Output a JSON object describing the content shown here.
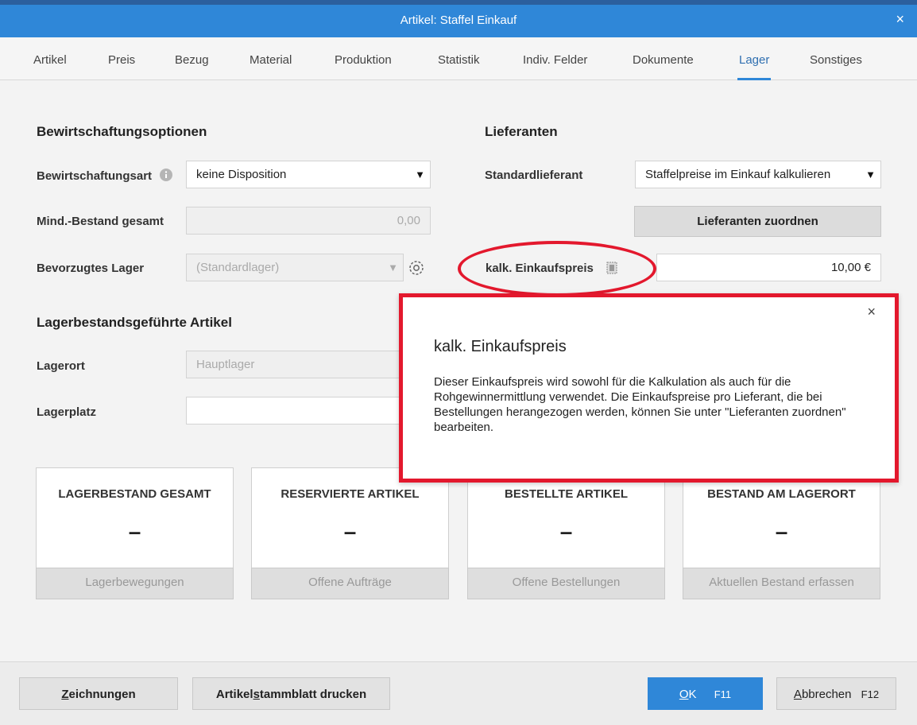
{
  "window": {
    "title": "Artikel: Staffel Einkauf",
    "close_symbol": "×"
  },
  "tabs": [
    {
      "label": "Artikel"
    },
    {
      "label": "Preis"
    },
    {
      "label": "Bezug"
    },
    {
      "label": "Material"
    },
    {
      "label": "Produktion"
    },
    {
      "label": "Statistik"
    },
    {
      "label": "Indiv. Felder"
    },
    {
      "label": "Dokumente"
    },
    {
      "label": "Lager"
    },
    {
      "label": "Sonstiges"
    }
  ],
  "active_tab": "Lager",
  "left": {
    "section_title": "Bewirtschaftungsoptionen",
    "bewirtschaftungsart": {
      "label": "Bewirtschaftungsart",
      "value": "keine Disposition"
    },
    "mind_bestand": {
      "label": "Mind.-Bestand gesamt",
      "value": "0,00"
    },
    "bevorzugtes_lager": {
      "label": "Bevorzugtes Lager",
      "value": "(Standardlager)"
    }
  },
  "lager_section": {
    "title": "Lagerbestandsgeführte Artikel",
    "lagerort": {
      "label": "Lagerort",
      "value": "Hauptlager"
    },
    "lagerplatz": {
      "label": "Lagerplatz",
      "value": ""
    }
  },
  "right": {
    "section_title": "Lieferanten",
    "standardlieferant": {
      "label": "Standardlieferant",
      "value": "Staffelpreise im Einkauf kalkulieren"
    },
    "assign_button": "Lieferanten zuordnen",
    "kalk": {
      "label": "kalk. Einkaufspreis",
      "value": "10,00 €"
    }
  },
  "tooltip": {
    "title": "kalk. Einkaufspreis",
    "body": "Dieser Einkaufspreis wird sowohl für die Kalkulation als auch für die Rohgewinnermittlung verwendet. Die Einkaufspreise pro Lieferant, die bei Bestellungen herangezogen werden, können Sie unter \"Lieferanten zuordnen\" bearbeiten.",
    "close": "×"
  },
  "cards": [
    {
      "title": "LAGERBESTAND GESAMT",
      "value": "–",
      "button": "Lagerbewegungen"
    },
    {
      "title": "RESERVIERTE ARTIKEL",
      "value": "–",
      "button": "Offene Aufträge"
    },
    {
      "title": "BESTELLTE ARTIKEL",
      "value": "–",
      "button": "Offene Bestellungen"
    },
    {
      "title": "BESTAND AM LAGERORT",
      "value": "–",
      "button": "Aktuellen Bestand erfassen"
    }
  ],
  "footer": {
    "zeichnungen": {
      "mnemonic": "Z",
      "rest": "eichnungen"
    },
    "drucken": {
      "before": "Artikel",
      "mnemonic": "s",
      "after": "tammblatt drucken"
    },
    "ok": {
      "mnemonic": "O",
      "rest": "K",
      "key": "F11"
    },
    "abbrechen": {
      "mnemonic": "A",
      "rest": "bbrechen",
      "key": "F12"
    }
  },
  "colors": {
    "accent": "#2f87d8",
    "highlight": "#e3182d"
  },
  "icons": {
    "info": "info-icon",
    "settings": "gear-icon",
    "dropdown": "caret-down-icon",
    "copy": "copy-icon"
  }
}
